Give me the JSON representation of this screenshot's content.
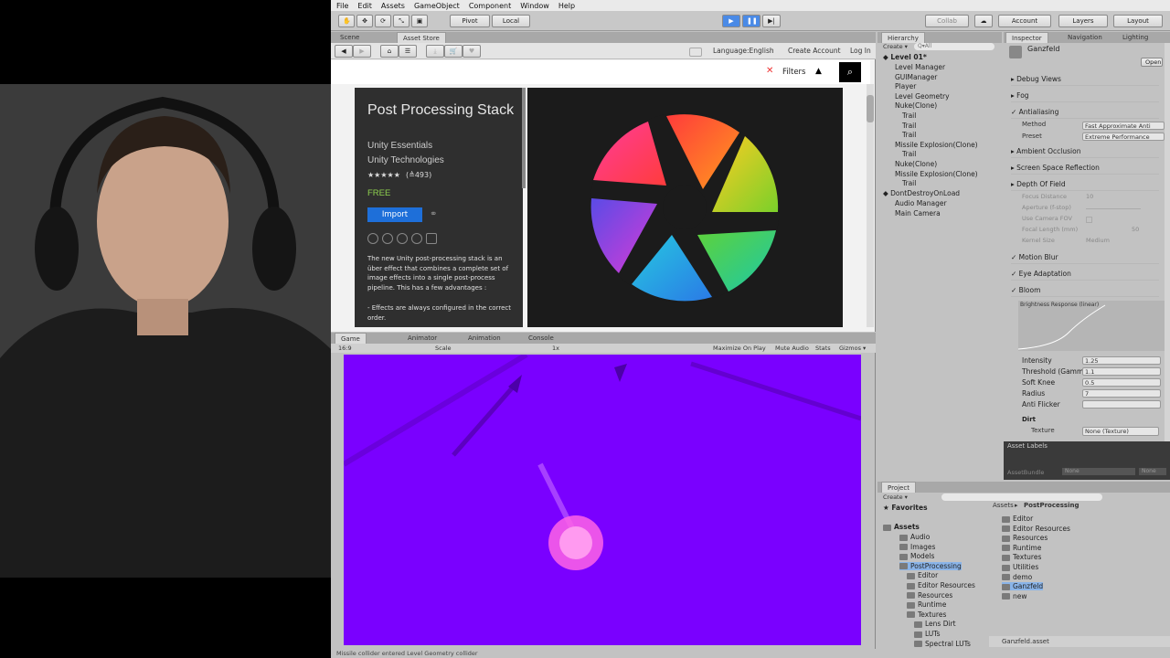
{
  "menu": [
    "File",
    "Edit",
    "Assets",
    "GameObject",
    "Component",
    "Window",
    "Help"
  ],
  "toolbar": {
    "pivot": "Pivot",
    "local": "Local",
    "collab": "Collab",
    "account": "Account",
    "layers": "Layers",
    "layout": "Layout"
  },
  "tabs": {
    "scene": "Scene",
    "asset_store": "Asset Store",
    "hierarchy": "Hierarchy",
    "inspector": "Inspector",
    "navigation": "Navigation",
    "lighting": "Lighting",
    "game": "Game",
    "animator": "Animator",
    "animation": "Animation",
    "console": "Console",
    "project": "Project"
  },
  "store_nav": {
    "language": "Language:English",
    "create_account": "Create Account",
    "login": "Log In",
    "filters": "Filters"
  },
  "asset": {
    "title": "Post Processing Stack",
    "category": "Unity Essentials",
    "publisher": "Unity Technologies",
    "rating_stars": "★★★★★",
    "rating_count": "(≜493)",
    "price": "FREE",
    "import_label": "Import",
    "description": "The new Unity post-processing stack is an über effect that combines a complete set of image effects into a single post-process pipeline. This has a few advantages :",
    "bullet": "- Effects are always configured in the correct order."
  },
  "hierarchy": {
    "create": "Create ▾",
    "search": "Q▾All",
    "scene": "Level 01*",
    "items": [
      {
        "label": "Level Manager",
        "indent": 1
      },
      {
        "label": "GUIManager",
        "indent": 1
      },
      {
        "label": "Player",
        "indent": 1
      },
      {
        "label": "Level Geometry",
        "indent": 1
      },
      {
        "label": "Nuke(Clone)",
        "indent": 1
      },
      {
        "label": "Trail",
        "indent": 2
      },
      {
        "label": "Trail",
        "indent": 2
      },
      {
        "label": "Trail",
        "indent": 2
      },
      {
        "label": "Missile Explosion(Clone)",
        "indent": 1
      },
      {
        "label": "Trail",
        "indent": 2
      },
      {
        "label": "Nuke(Clone)",
        "indent": 1
      },
      {
        "label": "Missile Explosion(Clone)",
        "indent": 1
      },
      {
        "label": "Trail",
        "indent": 2
      }
    ],
    "ddol": "DontDestroyOnLoad",
    "ddol_items": [
      "Audio Manager",
      "Main Camera"
    ]
  },
  "inspector": {
    "asset_name": "Ganzfeld",
    "open": "Open",
    "sections": [
      "Debug Views",
      "Fog",
      "Antialiasing"
    ],
    "method_label": "Method",
    "method_value": "Fast Approximate Anti",
    "preset_label": "Preset",
    "preset_value": "Extreme Performance",
    "sections2": [
      "Ambient Occlusion",
      "Screen Space Reflection",
      "Depth Of Field"
    ],
    "dof_fields": [
      "Focus Distance",
      "Aperture (f-stop)",
      "Use Camera FOV",
      "Focal Length (mm)",
      "Kernel Size"
    ],
    "dof_values": [
      "10",
      "",
      "",
      "50",
      "Medium"
    ],
    "sections3": [
      "Motion Blur",
      "Eye Adaptation",
      "Bloom"
    ],
    "brightness_label": "Brightness Response (linear)",
    "bloom_fields": [
      {
        "label": "Intensity",
        "value": "1.25"
      },
      {
        "label": "Threshold (Gamma)",
        "value": "1.1"
      },
      {
        "label": "Soft Knee",
        "value": "0.5"
      },
      {
        "label": "Radius",
        "value": "7"
      },
      {
        "label": "Anti Flicker",
        "value": ""
      }
    ],
    "dirt": "Dirt",
    "texture_label": "Texture",
    "texture_value": "None (Texture)",
    "asset_labels": "Asset Labels",
    "asset_bundle": "AssetBundle",
    "none1": "None",
    "none2": "None"
  },
  "game": {
    "aspect": "16:9",
    "scale_label": "Scale",
    "scale_value": "1x",
    "maximize": "Maximize On Play",
    "mute": "Mute Audio",
    "stats": "Stats",
    "gizmos": "Gizmos ▾"
  },
  "project": {
    "create": "Create ▾",
    "favorites": "Favorites",
    "assets": "Assets",
    "tree": [
      "Audio",
      "Images",
      "Models",
      "PostProcessing",
      "Editor",
      "Editor Resources",
      "Resources",
      "Runtime",
      "Textures",
      "Lens Dirt",
      "LUTs",
      "Spectral LUTs"
    ],
    "breadcrumb_root": "Assets",
    "breadcrumb_current": "PostProcessing",
    "files": [
      "Editor",
      "Editor Resources",
      "Resources",
      "Runtime",
      "Textures",
      "Utilities",
      "demo",
      "Ganzfeld",
      "new"
    ],
    "selected_file": "Ganzfeld.asset"
  },
  "status": "Missile collider entered Level Geometry collider",
  "colors": {
    "game_bg": "#7a00ff",
    "store_dark": "#2e2e2e",
    "import_blue": "#1e6fd9",
    "free_green": "#8fd14f"
  }
}
